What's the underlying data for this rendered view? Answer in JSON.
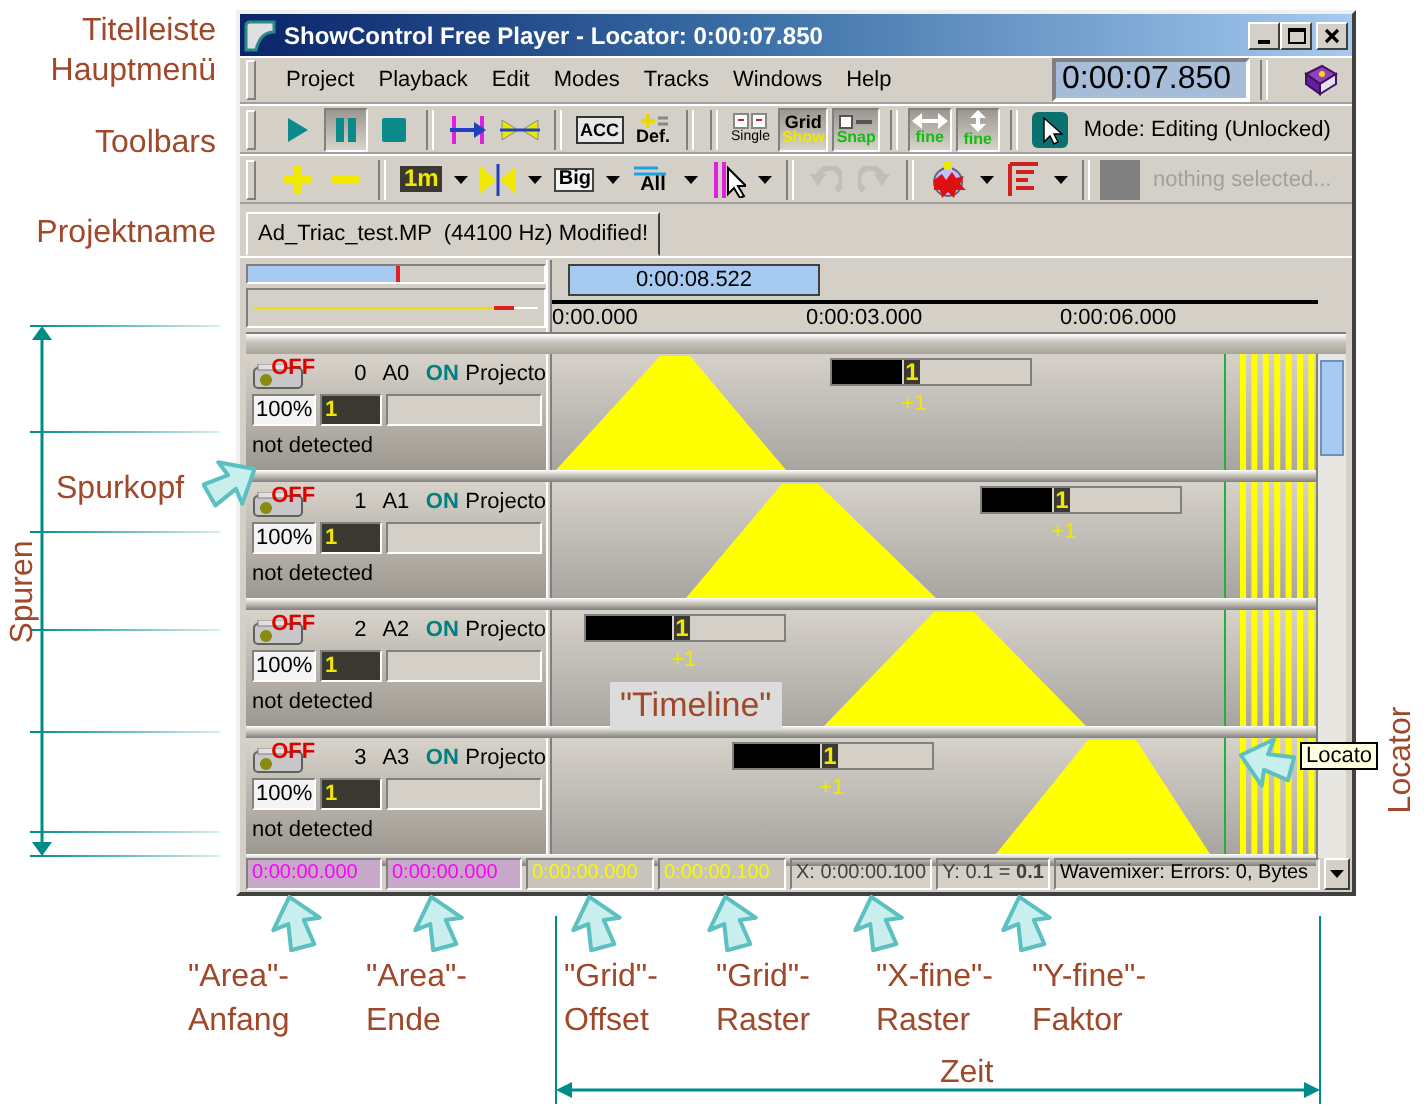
{
  "window": {
    "title": "ShowControl Free Player - Locator: 0:00:07.850"
  },
  "menu": [
    "Project",
    "Playback",
    "Edit",
    "Modes",
    "Tracks",
    "Windows",
    "Help"
  ],
  "time_display": "0:00:07.850",
  "toolbar_rows": [
    [
      {
        "kind": "play",
        "pressed": false,
        "disabled": false
      },
      {
        "kind": "pause",
        "pressed": true,
        "disabled": false
      },
      {
        "kind": "stop",
        "pressed": false,
        "disabled": false
      },
      {
        "kind": "separator"
      },
      {
        "kind": "marker",
        "pressed": false,
        "disabled": false
      },
      {
        "kind": "loop",
        "pressed": false,
        "disabled": false
      },
      {
        "kind": "separator"
      },
      {
        "kind": "acc",
        "label": "ACC",
        "pressed": false,
        "disabled": false
      },
      {
        "kind": "def",
        "label": "Def.",
        "pressed": false,
        "disabled": false
      },
      {
        "kind": "separator"
      },
      {
        "kind": "separator"
      },
      {
        "kind": "single",
        "label": "Single",
        "pressed": false,
        "disabled": false
      },
      {
        "kind": "grid",
        "label": "Grid",
        "sublabel": "Show",
        "pressed": true,
        "disabled": false
      },
      {
        "kind": "snap",
        "label": "Snap",
        "pressed": true,
        "disabled": false
      },
      {
        "kind": "separator"
      },
      {
        "kind": "hfine",
        "label": "fine",
        "pressed": true,
        "disabled": false
      },
      {
        "kind": "vfine",
        "label": "fine",
        "pressed": true,
        "disabled": false
      },
      {
        "kind": "separator"
      },
      {
        "kind": "mode",
        "label": "Mode: Editing (Unlocked)"
      }
    ],
    [
      {
        "kind": "plus",
        "pressed": false,
        "disabled": false
      },
      {
        "kind": "minus",
        "pressed": false,
        "disabled": false
      },
      {
        "kind": "separator"
      },
      {
        "kind": "length",
        "label": "1m",
        "pressed": false,
        "disabled": false
      },
      {
        "kind": "dropdown"
      },
      {
        "kind": "mirror",
        "pressed": false,
        "disabled": false
      },
      {
        "kind": "dropdown"
      },
      {
        "kind": "big",
        "label": "Big",
        "pressed": false,
        "disabled": false
      },
      {
        "kind": "dropdown"
      },
      {
        "kind": "all",
        "label": "All",
        "pressed": false,
        "disabled": false
      },
      {
        "kind": "dropdown"
      },
      {
        "kind": "select",
        "pressed": false,
        "disabled": false
      },
      {
        "kind": "dropdown"
      },
      {
        "kind": "separator"
      },
      {
        "kind": "undo",
        "pressed": false,
        "disabled": true
      },
      {
        "kind": "redo",
        "pressed": false,
        "disabled": true
      },
      {
        "kind": "separator"
      },
      {
        "kind": "fx",
        "pressed": false,
        "disabled": false
      },
      {
        "kind": "dropdown"
      },
      {
        "kind": "list",
        "pressed": false,
        "disabled": false
      },
      {
        "kind": "dropdown"
      },
      {
        "kind": "separator"
      },
      {
        "kind": "selection",
        "label": "nothing selected...",
        "disabled": true
      }
    ]
  ],
  "tabs": [
    {
      "label": "Ad_Triac_test.MP  (44100 Hz) Modified!",
      "selected": true
    }
  ],
  "ruler": {
    "range": "0:00:08.522",
    "ticks": [
      "0:00.000",
      "0:00:03.000",
      "0:00:06.000"
    ]
  },
  "tracks": [
    {
      "lamp": "OFF",
      "number": "0",
      "name": "A0",
      "on": "ON",
      "device": "Projecto",
      "volume": "100%",
      "value": "1",
      "status": "not detected",
      "cue": {
        "value": "1",
        "offset": "+1",
        "level": 0.35
      }
    },
    {
      "lamp": "OFF",
      "number": "1",
      "name": "A1",
      "on": "ON",
      "device": "Projecto",
      "volume": "100%",
      "value": "1",
      "status": "not detected",
      "cue": {
        "value": "1",
        "offset": "+1",
        "level": 0.35
      }
    },
    {
      "lamp": "OFF",
      "number": "2",
      "name": "A2",
      "on": "ON",
      "device": "Projecto",
      "volume": "100%",
      "value": "1",
      "status": "not detected",
      "cue": {
        "value": "1",
        "offset": "+1",
        "level": 0.43
      }
    },
    {
      "lamp": "OFF",
      "number": "3",
      "name": "A3",
      "on": "ON",
      "device": "Projecto",
      "volume": "100%",
      "value": "1",
      "status": "not detected",
      "cue": {
        "value": "1",
        "offset": "+1",
        "level": 0.43
      }
    }
  ],
  "locator_tooltip": "Locato",
  "status_bar": [
    {
      "kind": "area",
      "text": "0:00:00.000"
    },
    {
      "kind": "area",
      "text": "0:00:00.000"
    },
    {
      "kind": "grid",
      "text": "0:00:00.000"
    },
    {
      "kind": "grid",
      "text": "0:00:00.100"
    },
    {
      "kind": "plain",
      "text": "X: 0:00:00.100"
    },
    {
      "kind": "plain",
      "text": "Y: 0.1 = **0.1**"
    },
    {
      "kind": "dropdown",
      "text": "Wavemixer: Errors: 0, Bytes"
    }
  ],
  "annotations": {
    "side_labels": [
      "Titelleiste",
      "Hauptmenü",
      "Toolbars",
      "Projektname"
    ],
    "tracks_label": "Spuren",
    "track_head_label": "Spurkopf",
    "timeline_label": "\"Timeline\"",
    "locator_label": "Locator",
    "status_labels": [
      "\"Area\"-\nAnfang",
      "\"Area\"-\nEnde",
      "\"Grid\"-\nOffset",
      "\"Grid\"-\nRaster",
      "\"X-fine\"-\nRaster",
      "\"Y-fine\"-\nFaktor"
    ],
    "time_label": "Zeit"
  }
}
